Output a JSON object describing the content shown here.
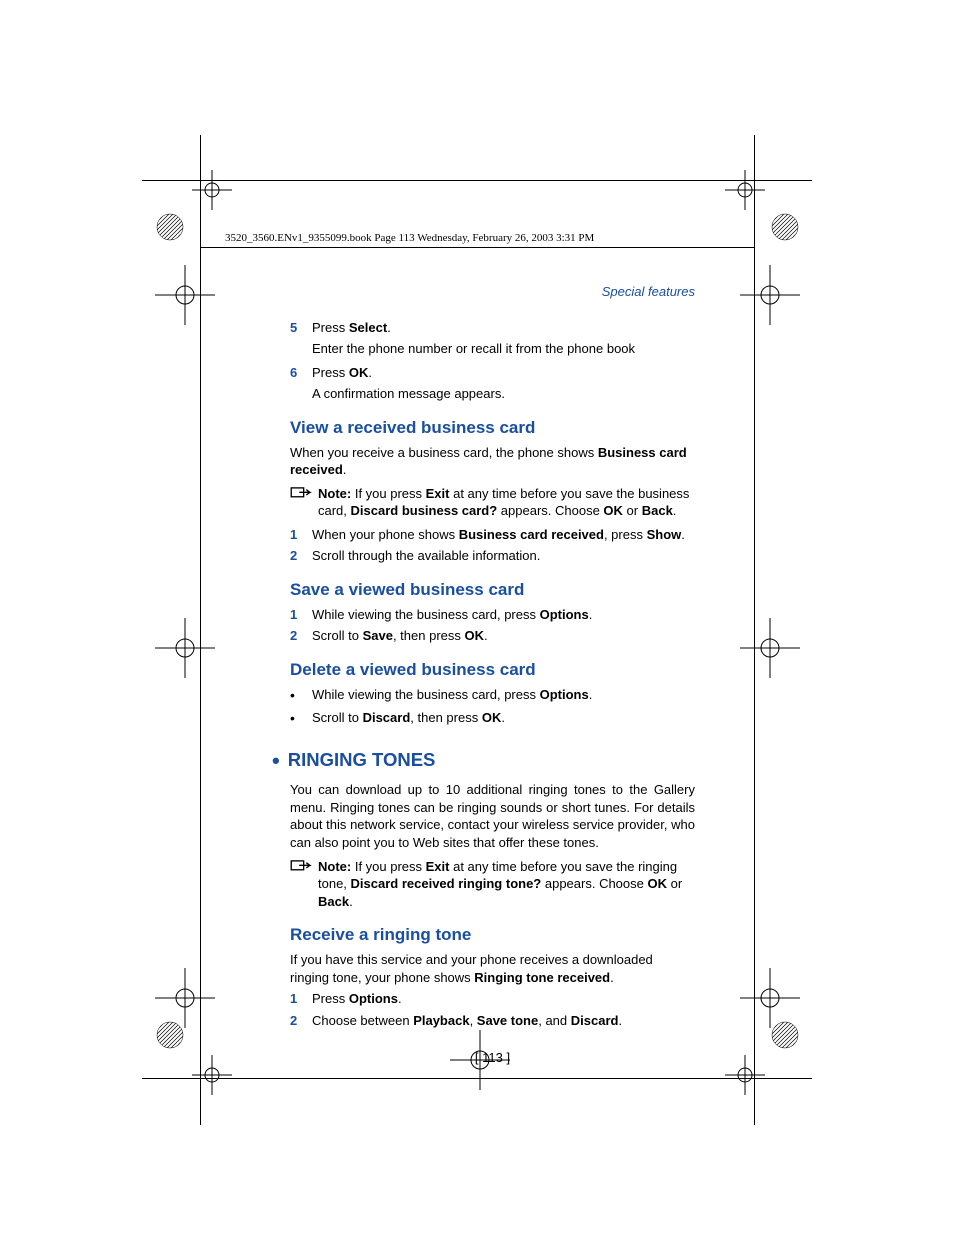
{
  "header": "3520_3560.ENv1_9355099.book  Page 113  Wednesday, February 26, 2003  3:31 PM",
  "section_label": "Special features",
  "step5": {
    "num": "5",
    "text_a": "Press ",
    "bold_a": "Select",
    "text_b": ".",
    "sub": "Enter the phone number or recall it from the phone book"
  },
  "step6": {
    "num": "6",
    "text_a": "Press ",
    "bold_a": "OK",
    "text_b": ".",
    "sub": "A confirmation message appears."
  },
  "view_heading": "View a received business card",
  "view_intro_a": "When you receive a business card, the phone shows ",
  "view_intro_bold": "Business card received",
  "view_intro_b": ".",
  "note1": {
    "label": "Note:",
    "a": " If you press ",
    "b1": "Exit",
    "c": " at any time before you save the business card, ",
    "b2": "Discard business card?",
    "d": " appears. Choose ",
    "b3": "OK",
    "e": " or ",
    "b4": "Back",
    "f": "."
  },
  "view_step1": {
    "num": "1",
    "a": "When your phone shows ",
    "b1": "Business card received",
    "b": ", press ",
    "b2": "Show",
    "c": "."
  },
  "view_step2": {
    "num": "2",
    "text": "Scroll through the available information."
  },
  "save_heading": "Save a viewed business card",
  "save_step1": {
    "num": "1",
    "a": "While viewing the business card, press ",
    "b1": "Options",
    "b": "."
  },
  "save_step2": {
    "num": "2",
    "a": "Scroll to ",
    "b1": "Save",
    "b": ", then press ",
    "b2": "OK",
    "c": "."
  },
  "delete_heading": "Delete a viewed business card",
  "delete_b1": {
    "a": "While viewing the business card, press ",
    "b1": "Options",
    "b": "."
  },
  "delete_b2": {
    "a": "Scroll to ",
    "b1": "Discard",
    "b": ", then press ",
    "b2": "OK",
    "c": "."
  },
  "ringing_heading": "RINGING TONES",
  "ringing_para": "You can download up to 10 additional ringing tones to the Gallery menu. Ringing tones can be ringing sounds or short tunes. For details about this network service, contact your wireless service provider, who can also point you to Web sites that offer these tones.",
  "note2": {
    "label": "Note:",
    "a": " If you press ",
    "b1": "Exit",
    "c": " at any time before you save the ringing tone, ",
    "b2": "Discard received ringing tone?",
    "d": " appears. Choose ",
    "b3": "OK",
    "e": " or ",
    "b4": "Back",
    "f": "."
  },
  "receive_heading": "Receive a ringing tone",
  "receive_para_a": "If you have this service and your phone receives a downloaded ringing tone, your phone shows ",
  "receive_para_bold": "Ringing tone received",
  "receive_para_b": ".",
  "receive_step1": {
    "num": "1",
    "a": "Press ",
    "b1": "Options",
    "b": "."
  },
  "receive_step2": {
    "num": "2",
    "a": "Choose between ",
    "b1": "Playback",
    "b": ", ",
    "b2": "Save tone",
    "c": ", and ",
    "b3": "Discard",
    "d": "."
  },
  "page_number": "[ 113 ]"
}
